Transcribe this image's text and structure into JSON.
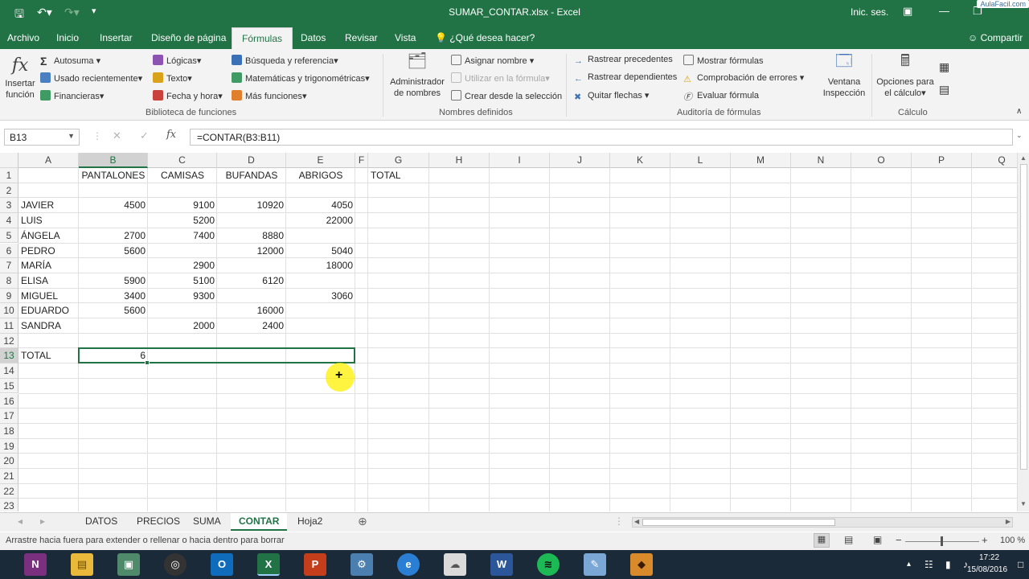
{
  "window": {
    "title": "SUMAR_CONTAR.xlsx - Excel",
    "signin": "Inic. ses.",
    "watermark": "AulaFacil.com"
  },
  "menu": {
    "tabs": [
      "Archivo",
      "Inicio",
      "Insertar",
      "Diseño de página",
      "Fórmulas",
      "Datos",
      "Revisar",
      "Vista"
    ],
    "active": "Fórmulas",
    "tell_me": "¿Qué desea hacer?",
    "share": "Compartir"
  },
  "ribbon": {
    "insert_function": [
      "Insertar",
      "función"
    ],
    "library": {
      "autosum": "Autosuma",
      "recent": "Usado recientemente",
      "financial": "Financieras",
      "logical": "Lógicas",
      "text": "Texto",
      "datetime": "Fecha y hora",
      "lookup": "Búsqueda y referencia",
      "math": "Matemáticas y trigonométricas",
      "more": "Más funciones",
      "group_label": "Biblioteca de funciones"
    },
    "names": {
      "manager": [
        "Administrador",
        "de nombres"
      ],
      "define": "Asignar nombre",
      "use_in_formula": "Utilizar en la fórmula",
      "create_from_selection": "Crear desde la selección",
      "group_label": "Nombres definidos"
    },
    "audit": {
      "trace_precedents": "Rastrear precedentes",
      "trace_dependents": "Rastrear dependientes",
      "remove_arrows": "Quitar flechas",
      "show_formulas": "Mostrar fórmulas",
      "error_checking": "Comprobación de errores",
      "evaluate": "Evaluar fórmula",
      "watch_window": [
        "Ventana",
        "Inspección"
      ],
      "group_label": "Auditoría de fórmulas"
    },
    "calc": {
      "options": [
        "Opciones para",
        "el cálculo"
      ],
      "group_label": "Cálculo"
    }
  },
  "formula_bar": {
    "name_box": "B13",
    "formula": "=CONTAR(B3:B11)"
  },
  "sheet": {
    "columns": [
      "A",
      "B",
      "C",
      "D",
      "E",
      "F",
      "G",
      "H",
      "I",
      "J",
      "K",
      "L",
      "M",
      "N",
      "O",
      "P",
      "Q"
    ],
    "row_numbers": [
      "1",
      "2",
      "3",
      "4",
      "5",
      "6",
      "7",
      "8",
      "9",
      "10",
      "11",
      "12",
      "13",
      "14",
      "15",
      "16",
      "17",
      "18",
      "19",
      "20",
      "21",
      "22",
      "23"
    ],
    "headers": {
      "B1": "PANTALONES",
      "C1": "CAMISAS",
      "D1": "BUFANDAS",
      "E1": "ABRIGOS",
      "G1": "TOTAL"
    },
    "names": [
      "JAVIER",
      "LUIS",
      "ÁNGELA",
      "PEDRO",
      "MARÍA",
      "ELISA",
      "MIGUEL",
      "EDUARDO",
      "SANDRA"
    ],
    "values": [
      [
        "4500",
        "9100",
        "10920",
        "4050"
      ],
      [
        "",
        "5200",
        "",
        "22000"
      ],
      [
        "2700",
        "7400",
        "8880",
        ""
      ],
      [
        "5600",
        "",
        "12000",
        "5040"
      ],
      [
        "",
        "2900",
        "",
        "18000"
      ],
      [
        "5900",
        "5100",
        "6120",
        ""
      ],
      [
        "3400",
        "9300",
        "",
        "3060"
      ],
      [
        "5600",
        "",
        "16000",
        ""
      ],
      [
        "",
        "2000",
        "2400",
        ""
      ]
    ],
    "total_label": "TOTAL",
    "total_value": "6"
  },
  "sheet_tabs": {
    "tabs": [
      "DATOS",
      "PRECIOS",
      "SUMA",
      "CONTAR",
      "Hoja2"
    ],
    "active": "CONTAR"
  },
  "status": {
    "message": "Arrastre hacia fuera para extender o rellenar o hacia dentro para borrar",
    "zoom": "100 %"
  },
  "taskbar": {
    "time": "17:22",
    "date": "15/08/2016"
  }
}
